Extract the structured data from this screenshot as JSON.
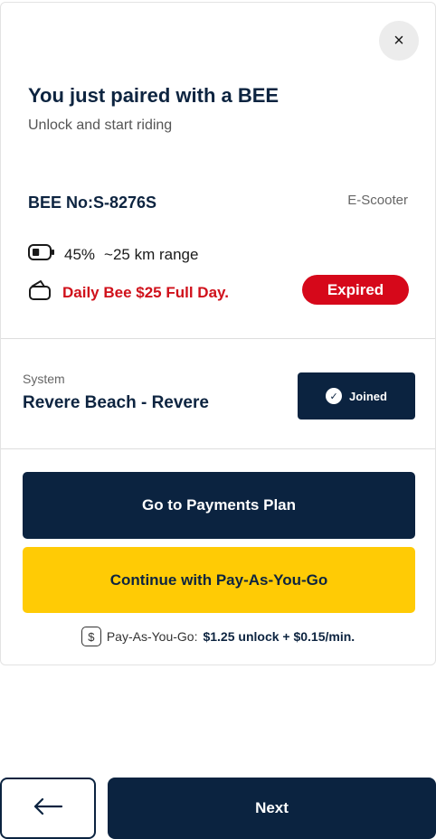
{
  "header": {
    "close_label": "×",
    "title": "You just paired with a BEE",
    "subtitle": "Unlock and start riding"
  },
  "vehicle": {
    "number": "BEE No:S-8276S",
    "type": "E-Scooter",
    "battery_percent": "45%",
    "battery_level": 0.45,
    "range": "~25 km range",
    "plan": "Daily Bee $25 Full Day.",
    "plan_status": "Expired"
  },
  "system": {
    "label": "System",
    "name": "Revere Beach - Revere",
    "status_label": "Joined"
  },
  "actions": {
    "payments_plan_label": "Go to Payments Plan",
    "payg_label": "Continue with Pay-As-You-Go"
  },
  "pricing": {
    "prefix": "Pay-As-You-Go:",
    "value": "$1.25 unlock + $0.15/min."
  },
  "footer": {
    "next_label": "Next"
  },
  "colors": {
    "navy": "#0b2340",
    "yellow": "#ffcb05",
    "expired_red": "#d6081a",
    "plan_red": "#d0111b"
  },
  "icons": [
    "close-icon",
    "battery-icon",
    "wallet-icon",
    "check-circle-icon",
    "dollar-icon",
    "arrow-left-icon"
  ]
}
